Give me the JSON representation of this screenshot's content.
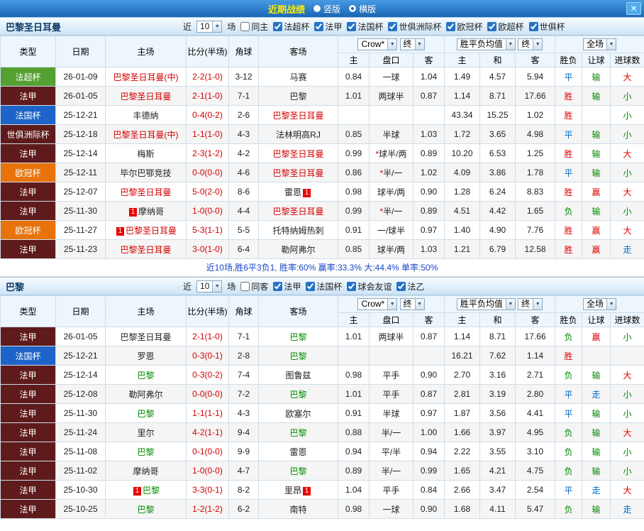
{
  "titlebar": {
    "title": "近期战绩",
    "options": [
      {
        "label": "竖版",
        "selected": false
      },
      {
        "label": "横版",
        "selected": true
      }
    ],
    "close": "✕"
  },
  "table_header": {
    "type": "类型",
    "date": "日期",
    "home": "主场",
    "score": "比分(半场)",
    "corner": "角球",
    "away": "客场",
    "odds_source": "Crow*",
    "odds_time": "终",
    "odds_cols": [
      "主",
      "盘口",
      "客"
    ],
    "avg_label": "胜平负均值",
    "avg_time": "终",
    "avg_cols": [
      "主",
      "和",
      "客"
    ],
    "scope_label": "全场",
    "scope_cols": [
      "胜负",
      "让球",
      "进球数"
    ]
  },
  "colors": {
    "league_bg": {
      "法超杯": "#55a032",
      "法甲": "#5f1b1b",
      "法国杯": "#1e64c8",
      "世俱洲际杯": "#5f1b1b",
      "欧冠杯": "#e8730a"
    },
    "outcome": {
      "胜": "#e10000",
      "赢": "#e10000",
      "大": "#e10000",
      "负": "#008a00",
      "输": "#008a00",
      "小": "#008a00",
      "平": "#0067c0",
      "走": "#0067c0"
    },
    "team_red": "#d40000",
    "team_green": "#008a00",
    "score": "#d40000",
    "badge_bg": "#e80000"
  },
  "sections": [
    {
      "team": "巴黎圣日耳曼",
      "filter": {
        "near_label": "近",
        "count": "10",
        "unit": "场",
        "checkboxes": [
          {
            "label": "同主",
            "checked": false
          },
          {
            "label": "法超杯",
            "checked": true
          },
          {
            "label": "法甲",
            "checked": true
          },
          {
            "label": "法国杯",
            "checked": true
          },
          {
            "label": "世俱洲际杯",
            "checked": true
          },
          {
            "label": "欧冠杯",
            "checked": true
          },
          {
            "label": "欧超杯",
            "checked": true
          },
          {
            "label": "世俱杯",
            "checked": true
          }
        ]
      },
      "rows": [
        {
          "league": "法超杯",
          "date": "26-01-09",
          "home": {
            "name": "巴黎圣日耳曼(中)",
            "color": "red"
          },
          "score": "2-2(1-0)",
          "corner": "3-12",
          "away": {
            "name": "马赛",
            "color": ""
          },
          "odds": [
            "0.84",
            "一球",
            "1.04"
          ],
          "avg": [
            "1.49",
            "4.57",
            "5.94"
          ],
          "results": [
            "平",
            "输",
            "大"
          ]
        },
        {
          "league": "法甲",
          "date": "26-01-05",
          "home": {
            "name": "巴黎圣日耳曼",
            "color": "red"
          },
          "score": "2-1(1-0)",
          "corner": "7-1",
          "away": {
            "name": "巴黎",
            "color": ""
          },
          "odds": [
            "1.01",
            "两球半",
            "0.87"
          ],
          "avg": [
            "1.14",
            "8.71",
            "17.66"
          ],
          "results": [
            "胜",
            "输",
            "小"
          ]
        },
        {
          "league": "法国杯",
          "date": "25-12-21",
          "home": {
            "name": "丰德纳",
            "color": ""
          },
          "score": "0-4(0-2)",
          "corner": "2-6",
          "away": {
            "name": "巴黎圣日耳曼",
            "color": "red"
          },
          "odds": [
            "",
            "",
            ""
          ],
          "avg": [
            "43.34",
            "15.25",
            "1.02"
          ],
          "results": [
            "胜",
            "",
            "小"
          ]
        },
        {
          "league": "世俱洲际杯",
          "date": "25-12-18",
          "home": {
            "name": "巴黎圣日耳曼(中)",
            "color": "red"
          },
          "score": "1-1(1-0)",
          "corner": "4-3",
          "away": {
            "name": "法林明高RJ",
            "color": ""
          },
          "odds": [
            "0.85",
            "半球",
            "1.03"
          ],
          "avg": [
            "1.72",
            "3.65",
            "4.98"
          ],
          "results": [
            "平",
            "输",
            "小"
          ]
        },
        {
          "league": "法甲",
          "date": "25-12-14",
          "home": {
            "name": "梅斯",
            "color": ""
          },
          "score": "2-3(1-2)",
          "corner": "4-2",
          "away": {
            "name": "巴黎圣日耳曼",
            "color": "red"
          },
          "odds": [
            "0.99",
            "*球半/两",
            "0.89"
          ],
          "avg": [
            "10.20",
            "6.53",
            "1.25"
          ],
          "results": [
            "胜",
            "输",
            "大"
          ]
        },
        {
          "league": "欧冠杯",
          "date": "25-12-11",
          "home": {
            "name": "毕尔巴鄂竞技",
            "color": ""
          },
          "score": "0-0(0-0)",
          "corner": "4-6",
          "away": {
            "name": "巴黎圣日耳曼",
            "color": "red"
          },
          "odds": [
            "0.86",
            "*半/一",
            "1.02"
          ],
          "avg": [
            "4.09",
            "3.86",
            "1.78"
          ],
          "results": [
            "平",
            "输",
            "小"
          ]
        },
        {
          "league": "法甲",
          "date": "25-12-07",
          "home": {
            "name": "巴黎圣日耳曼",
            "color": "red"
          },
          "score": "5-0(2-0)",
          "corner": "8-6",
          "away": {
            "name": "雷恩",
            "color": "",
            "badge": "1",
            "badge_pos": "after"
          },
          "odds": [
            "0.98",
            "球半/两",
            "0.90"
          ],
          "avg": [
            "1.28",
            "6.24",
            "8.83"
          ],
          "results": [
            "胜",
            "赢",
            "大"
          ]
        },
        {
          "league": "法甲",
          "date": "25-11-30",
          "home": {
            "name": "摩纳哥",
            "color": "",
            "badge": "1",
            "badge_pos": "before"
          },
          "score": "1-0(0-0)",
          "corner": "4-4",
          "away": {
            "name": "巴黎圣日耳曼",
            "color": "red"
          },
          "odds": [
            "0.99",
            "*半/一",
            "0.89"
          ],
          "avg": [
            "4.51",
            "4.42",
            "1.65"
          ],
          "results": [
            "负",
            "输",
            "小"
          ]
        },
        {
          "league": "欧冠杯",
          "date": "25-11-27",
          "home": {
            "name": "巴黎圣日耳曼",
            "color": "red",
            "badge": "1",
            "badge_pos": "before"
          },
          "score": "5-3(1-1)",
          "corner": "5-5",
          "away": {
            "name": "托特纳姆热刺",
            "color": ""
          },
          "odds": [
            "0.91",
            "一/球半",
            "0.97"
          ],
          "avg": [
            "1.40",
            "4.90",
            "7.76"
          ],
          "results": [
            "胜",
            "赢",
            "大"
          ]
        },
        {
          "league": "法甲",
          "date": "25-11-23",
          "home": {
            "name": "巴黎圣日耳曼",
            "color": "red"
          },
          "score": "3-0(1-0)",
          "corner": "6-4",
          "away": {
            "name": "勒阿弗尔",
            "color": ""
          },
          "odds": [
            "0.85",
            "球半/两",
            "1.03"
          ],
          "avg": [
            "1.21",
            "6.79",
            "12.58"
          ],
          "results": [
            "胜",
            "赢",
            "走"
          ]
        }
      ],
      "summary": "近10场,胜6平3负1, 胜率:60% 赢率:33.3% 大:44.4% 单率:50%"
    },
    {
      "team": "巴黎",
      "filter": {
        "near_label": "近",
        "count": "10",
        "unit": "场",
        "checkboxes": [
          {
            "label": "同客",
            "checked": false
          },
          {
            "label": "法甲",
            "checked": true
          },
          {
            "label": "法国杯",
            "checked": true
          },
          {
            "label": "球会友谊",
            "checked": true
          },
          {
            "label": "法乙",
            "checked": true
          }
        ]
      },
      "rows": [
        {
          "league": "法甲",
          "date": "26-01-05",
          "home": {
            "name": "巴黎圣日耳曼",
            "color": ""
          },
          "score": "2-1(1-0)",
          "corner": "7-1",
          "away": {
            "name": "巴黎",
            "color": "green"
          },
          "odds": [
            "1.01",
            "两球半",
            "0.87"
          ],
          "avg": [
            "1.14",
            "8.71",
            "17.66"
          ],
          "results": [
            "负",
            "赢",
            "小"
          ]
        },
        {
          "league": "法国杯",
          "date": "25-12-21",
          "home": {
            "name": "罗恩",
            "color": ""
          },
          "score": "0-3(0-1)",
          "corner": "2-8",
          "away": {
            "name": "巴黎",
            "color": "green"
          },
          "odds": [
            "",
            "",
            ""
          ],
          "avg": [
            "16.21",
            "7.62",
            "1.14"
          ],
          "results": [
            "胜",
            "",
            ""
          ]
        },
        {
          "league": "法甲",
          "date": "25-12-14",
          "home": {
            "name": "巴黎",
            "color": "green"
          },
          "score": "0-3(0-2)",
          "corner": "7-4",
          "away": {
            "name": "图鲁兹",
            "color": ""
          },
          "odds": [
            "0.98",
            "平手",
            "0.90"
          ],
          "avg": [
            "2.70",
            "3.16",
            "2.71"
          ],
          "results": [
            "负",
            "输",
            "大"
          ]
        },
        {
          "league": "法甲",
          "date": "25-12-08",
          "home": {
            "name": "勒阿弗尔",
            "color": ""
          },
          "score": "0-0(0-0)",
          "corner": "7-2",
          "away": {
            "name": "巴黎",
            "color": "green"
          },
          "odds": [
            "1.01",
            "平手",
            "0.87"
          ],
          "avg": [
            "2.81",
            "3.19",
            "2.80"
          ],
          "results": [
            "平",
            "走",
            "小"
          ]
        },
        {
          "league": "法甲",
          "date": "25-11-30",
          "home": {
            "name": "巴黎",
            "color": "green"
          },
          "score": "1-1(1-1)",
          "corner": "4-3",
          "away": {
            "name": "欧塞尔",
            "color": ""
          },
          "odds": [
            "0.91",
            "半球",
            "0.97"
          ],
          "avg": [
            "1.87",
            "3.56",
            "4.41"
          ],
          "results": [
            "平",
            "输",
            "小"
          ]
        },
        {
          "league": "法甲",
          "date": "25-11-24",
          "home": {
            "name": "里尔",
            "color": ""
          },
          "score": "4-2(1-1)",
          "corner": "9-4",
          "away": {
            "name": "巴黎",
            "color": "green"
          },
          "odds": [
            "0.88",
            "半/一",
            "1.00"
          ],
          "avg": [
            "1.66",
            "3.97",
            "4.95"
          ],
          "results": [
            "负",
            "输",
            "大"
          ]
        },
        {
          "league": "法甲",
          "date": "25-11-08",
          "home": {
            "name": "巴黎",
            "color": "green"
          },
          "score": "0-1(0-0)",
          "corner": "9-9",
          "away": {
            "name": "雷恩",
            "color": ""
          },
          "odds": [
            "0.94",
            "平/半",
            "0.94"
          ],
          "avg": [
            "2.22",
            "3.55",
            "3.10"
          ],
          "results": [
            "负",
            "输",
            "小"
          ]
        },
        {
          "league": "法甲",
          "date": "25-11-02",
          "home": {
            "name": "摩纳哥",
            "color": ""
          },
          "score": "1-0(0-0)",
          "corner": "4-7",
          "away": {
            "name": "巴黎",
            "color": "green"
          },
          "odds": [
            "0.89",
            "半/一",
            "0.99"
          ],
          "avg": [
            "1.65",
            "4.21",
            "4.75"
          ],
          "results": [
            "负",
            "输",
            "小"
          ]
        },
        {
          "league": "法甲",
          "date": "25-10-30",
          "home": {
            "name": "巴黎",
            "color": "green",
            "badge": "1",
            "badge_pos": "before"
          },
          "score": "3-3(0-1)",
          "corner": "8-2",
          "away": {
            "name": "里昂",
            "color": "",
            "badge": "1",
            "badge_pos": "after"
          },
          "odds": [
            "1.04",
            "平手",
            "0.84"
          ],
          "avg": [
            "2.66",
            "3.47",
            "2.54"
          ],
          "results": [
            "平",
            "走",
            "大"
          ]
        },
        {
          "league": "法甲",
          "date": "25-10-25",
          "home": {
            "name": "巴黎",
            "color": "green"
          },
          "score": "1-2(1-2)",
          "corner": "6-2",
          "away": {
            "name": "南特",
            "color": ""
          },
          "odds": [
            "0.98",
            "一球",
            "0.90"
          ],
          "avg": [
            "1.68",
            "4.11",
            "5.47"
          ],
          "results": [
            "负",
            "输",
            "走"
          ]
        }
      ],
      "summary": ""
    }
  ]
}
